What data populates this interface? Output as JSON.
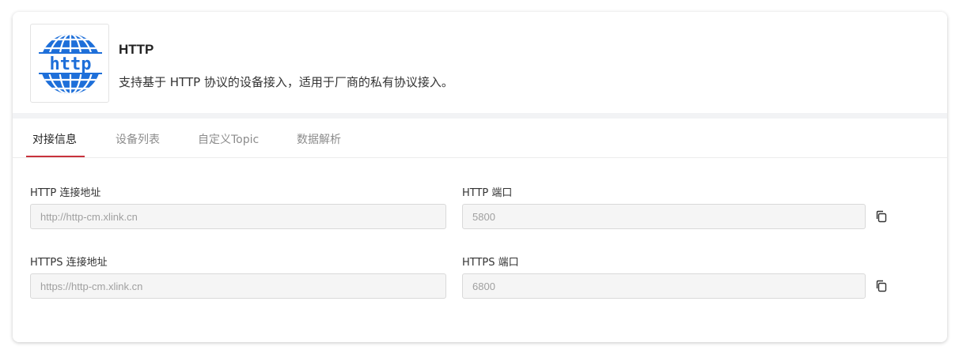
{
  "protocol": {
    "name": "HTTP",
    "description": "支持基于 HTTP 协议的设备接入，适用于厂商的私有协议接入。",
    "logo_text": "http",
    "logo_icon": "globe-icon",
    "logo_color": "#1e6fd9"
  },
  "tabs": [
    {
      "label": "对接信息",
      "active": true
    },
    {
      "label": "设备列表",
      "active": false
    },
    {
      "label": "自定义Topic",
      "active": false
    },
    {
      "label": "数据解析",
      "active": false
    }
  ],
  "accent_color": "#c8323c",
  "fields": {
    "http_address": {
      "label": "HTTP 连接地址",
      "value": "http://http-cm.xlink.cn"
    },
    "http_port": {
      "label": "HTTP 端口",
      "value": "5800"
    },
    "https_address": {
      "label": "HTTPS 连接地址",
      "value": "https://http-cm.xlink.cn"
    },
    "https_port": {
      "label": "HTTPS 端口",
      "value": "6800"
    }
  },
  "copy_icon": "copy-icon"
}
